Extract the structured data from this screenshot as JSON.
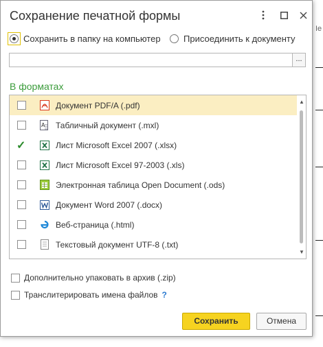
{
  "window": {
    "title": "Сохранение печатной формы",
    "menu_icon": "kebab-menu-icon",
    "maximize_icon": "maximize-icon",
    "close_icon": "close-icon"
  },
  "destination": {
    "save_to_folder_label": "Сохранить в папку на компьютер",
    "save_to_folder_selected": true,
    "attach_label": "Присоединить к документу",
    "attach_selected": false,
    "path_value": "",
    "browse_label": "..."
  },
  "formats": {
    "heading": "В форматах",
    "items": [
      {
        "label": "Документ PDF/A (.pdf)",
        "checked": false,
        "icon": "pdf-icon"
      },
      {
        "label": "Табличный документ (.mxl)",
        "checked": false,
        "icon": "spreadsheet-doc-icon"
      },
      {
        "label": "Лист Microsoft Excel 2007 (.xlsx)",
        "checked": true,
        "icon": "excel-icon"
      },
      {
        "label": "Лист Microsoft Excel 97-2003 (.xls)",
        "checked": false,
        "icon": "excel-icon"
      },
      {
        "label": "Электронная таблица Open Document (.ods)",
        "checked": false,
        "icon": "ods-icon"
      },
      {
        "label": "Документ Word 2007 (.docx)",
        "checked": false,
        "icon": "word-icon"
      },
      {
        "label": "Веб-страница (.html)",
        "checked": false,
        "icon": "web-page-icon"
      },
      {
        "label": "Текстовый документ UTF-8 (.txt)",
        "checked": false,
        "icon": "text-doc-icon"
      }
    ]
  },
  "options": {
    "zip_label": "Дополнительно упаковать в архив (.zip)",
    "zip_checked": false,
    "transliterate_label": "Транслитерировать имена файлов",
    "transliterate_checked": false,
    "help_label": "?"
  },
  "buttons": {
    "save_label": "Сохранить",
    "cancel_label": "Отмена"
  },
  "background": {
    "fragment_text": "Iе"
  },
  "colors": {
    "accent_yellow": "#f6d320",
    "section_green": "#3a9b3a",
    "selected_row": "#fbeec2"
  }
}
